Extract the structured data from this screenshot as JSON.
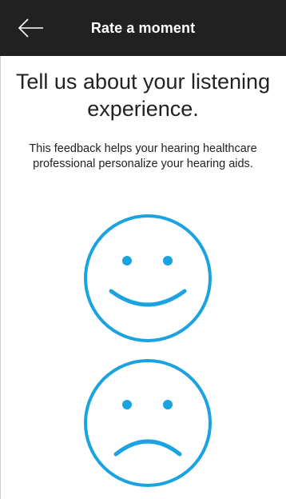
{
  "header": {
    "title": "Rate a moment",
    "back_icon": "arrow-left-icon"
  },
  "main": {
    "headline": "Tell us about your listening experience.",
    "description": "This feedback helps your hearing healthcare professional personalize your hearing aids.",
    "options": [
      {
        "icon": "happy-face-icon"
      },
      {
        "icon": "sad-face-icon"
      }
    ]
  },
  "colors": {
    "app_bar": "#212121",
    "face_accent": "#1aa3e0",
    "text": "#222222"
  }
}
